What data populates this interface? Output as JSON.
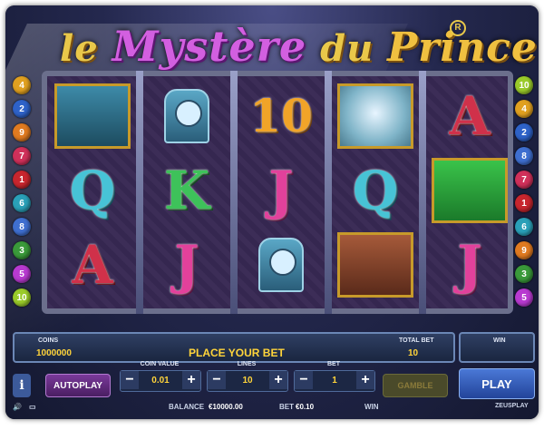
{
  "game": {
    "title_part1": "le",
    "title_part2": "Mystère",
    "title_part3": "du",
    "title_part4": "Prince",
    "registered_mark": "R"
  },
  "reels": [
    [
      {
        "type": "pic",
        "name": "horse-symbol"
      },
      {
        "type": "letter",
        "value": "Q",
        "cls": "lQ"
      },
      {
        "type": "letter",
        "value": "A",
        "cls": "lA"
      }
    ],
    [
      {
        "type": "clock",
        "name": "clock-symbol"
      },
      {
        "type": "letter",
        "value": "K",
        "cls": "lK"
      },
      {
        "type": "letter",
        "value": "J",
        "cls": "lJ"
      }
    ],
    [
      {
        "type": "letter",
        "value": "10",
        "cls": "l10"
      },
      {
        "type": "letter",
        "value": "J",
        "cls": "lJ"
      },
      {
        "type": "clock",
        "name": "clock-symbol"
      }
    ],
    [
      {
        "type": "pic",
        "name": "rose-symbol"
      },
      {
        "type": "letter",
        "value": "Q",
        "cls": "lQ"
      },
      {
        "type": "pic",
        "name": "beast-symbol"
      }
    ],
    [
      {
        "type": "letter",
        "value": "A",
        "cls": "lA"
      },
      {
        "type": "pic",
        "name": "woman-symbol"
      },
      {
        "type": "letter",
        "value": "J",
        "cls": "lJ"
      }
    ]
  ],
  "paylines_left": [
    "4",
    "2",
    "9",
    "7",
    "1",
    "6",
    "8",
    "3",
    "5",
    "10"
  ],
  "paylines_right": [
    "10",
    "4",
    "2",
    "8",
    "7",
    "1",
    "6",
    "9",
    "3",
    "5"
  ],
  "payline_colors": {
    "1": "#c8262e",
    "2": "#2e62c8",
    "3": "#3a9a3a",
    "4": "#e0a020",
    "5": "#b83ad0",
    "6": "#2aa0b8",
    "7": "#d0305a",
    "8": "#3f6fd0",
    "9": "#e07a20",
    "10": "#9acb2a"
  },
  "panel": {
    "coins_label": "COINS",
    "coins_value": "1000000",
    "message": "PLACE YOUR BET",
    "total_bet_label": "TOTAL BET",
    "total_bet_value": "10",
    "win_label": "WIN",
    "info_label": "i",
    "autoplay_label": "AUTOPLAY",
    "coin_value_label": "COIN VALUE",
    "coin_value": "0.01",
    "lines_label": "LINES",
    "lines_value": "10",
    "bet_label": "BET",
    "bet_value": "1",
    "gamble_label": "GAMBLE",
    "play_label": "PLAY",
    "minus": "−",
    "plus": "+",
    "balance_label": "BALANCE",
    "balance_value": "€10000.00",
    "bet_footer_label": "BET",
    "bet_footer_value": "€0.10",
    "win_footer_label": "WIN",
    "brand": "ZEUSPLAY"
  }
}
